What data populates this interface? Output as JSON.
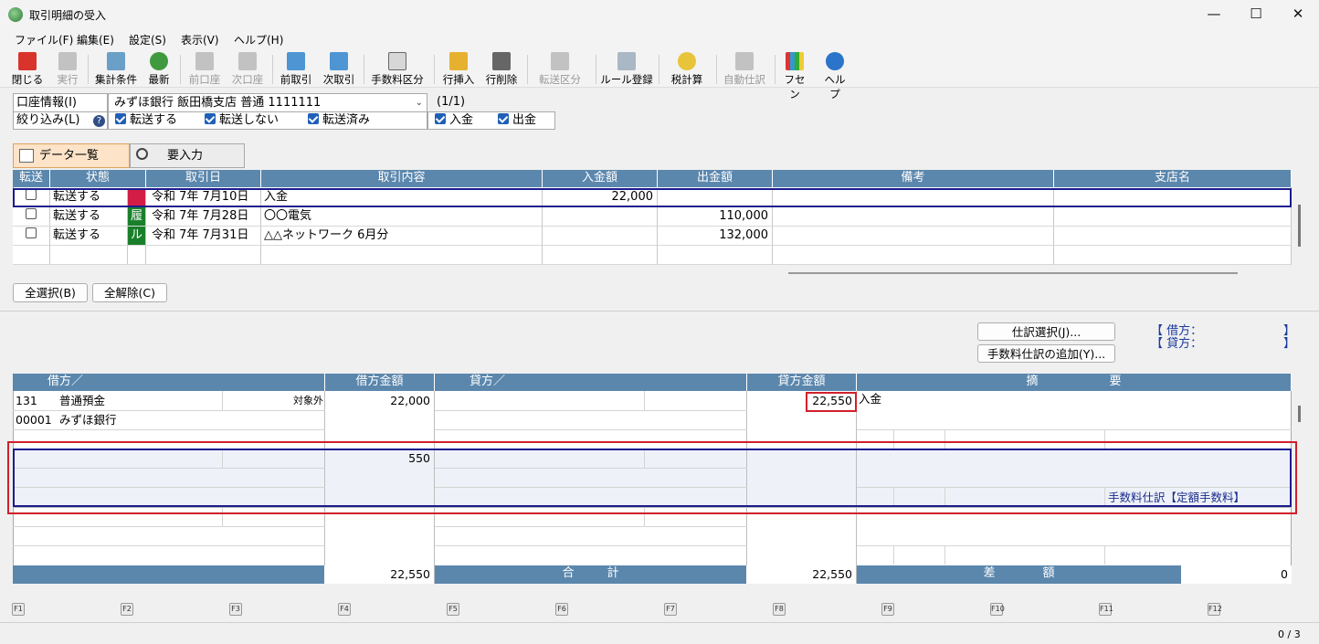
{
  "window": {
    "title": "取引明細の受入"
  },
  "menu": [
    "ファイル(F)",
    "編集(E)",
    "設定(S)",
    "表示(V)",
    "ヘルプ(H)"
  ],
  "toolbar": {
    "close": "閉じる",
    "run": "実行",
    "agg": "集計条件",
    "refresh": "最新",
    "prev_acct": "前口座",
    "next_acct": "次口座",
    "prev_tx": "前取引",
    "next_tx": "次取引",
    "fee_class": "手数料区分",
    "row_insert": "行挿入",
    "row_delete": "行削除",
    "transfer_class": "転送区分",
    "rule_register": "ルール登録",
    "tax_calc": "税計算",
    "auto_journal": "自動仕訳",
    "fusen": "フセン",
    "help": "ヘルプ"
  },
  "account": {
    "label": "口座情報(I)",
    "value": "みずほ銀行 飯田橋支店 普通 1111111",
    "page": "(1/1)"
  },
  "filter": {
    "label": "絞り込み(L)",
    "transfer": "転送する",
    "no_transfer": "転送しない",
    "transferred": "転送済み",
    "deposit": "入金",
    "withdrawal": "出金"
  },
  "tabs": {
    "data_list": "データ一覧",
    "needs_input": "要入力"
  },
  "list": {
    "headers": [
      "転送",
      "状態",
      "取引日",
      "取引内容",
      "入金額",
      "出金額",
      "備考",
      "支店名"
    ],
    "rows": [
      {
        "status": "転送する",
        "badge": "",
        "badge_color": "#d21e46",
        "date": "令和 7年 7月10日",
        "desc": "入金",
        "in": "22,000",
        "out": ""
      },
      {
        "status": "転送する",
        "badge": "履",
        "badge_color": "#1a7f2a",
        "date": "令和 7年 7月28日",
        "desc": "〇〇電気",
        "in": "",
        "out": "110,000"
      },
      {
        "status": "転送する",
        "badge": "ル",
        "badge_color": "#1a7f2a",
        "date": "令和 7年 7月31日",
        "desc": "△△ネットワーク 6月分",
        "in": "",
        "out": "132,000"
      }
    ]
  },
  "buttons": {
    "select_all": "全選択(B)",
    "deselect_all": "全解除(C)",
    "journal_select": "仕訳選択(J)...",
    "add_fee_journal": "手数料仕訳の追加(Y)..."
  },
  "summary": {
    "debit": "【 借方：",
    "credit": "【 貸方：",
    "close": "】"
  },
  "journal": {
    "headers": {
      "debit": "借方／",
      "debit_amount": "借方金額",
      "credit": "貸方／",
      "credit_amount": "貸方金額",
      "memo_1": "摘",
      "memo_2": "要"
    },
    "row1": {
      "code": "131",
      "account": "普通預金",
      "tax": "対象外",
      "sub_code": "00001",
      "sub_name": "みずほ銀行",
      "debit_amount": "22,000",
      "credit_amount": "22,550",
      "memo": "入金"
    },
    "row2": {
      "debit_amount": "550",
      "memo": "手数料仕訳【定額手数料】"
    },
    "totals": {
      "debit_total": "22,550",
      "label_1": "合",
      "label_2": "計",
      "credit_total": "22,550",
      "diff_1": "差",
      "diff_2": "額",
      "diff": "0"
    }
  },
  "fkeys": [
    "F1",
    "F2",
    "F3",
    "F4",
    "F5",
    "F6",
    "F7",
    "F8",
    "F9",
    "F10",
    "F11",
    "F12"
  ],
  "status": {
    "count": "0 / 3"
  }
}
